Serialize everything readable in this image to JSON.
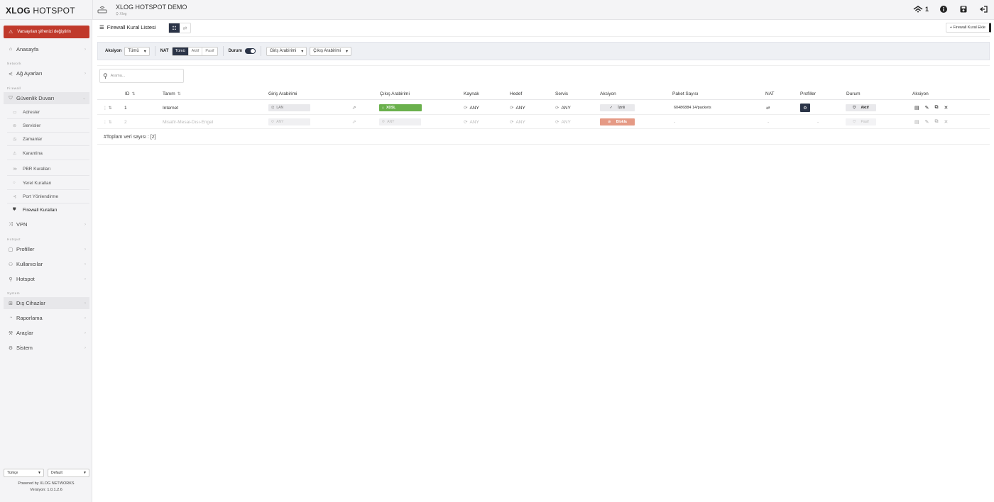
{
  "app": {
    "brand_bold": "XLOG",
    "brand_rest": " HOTSPOT",
    "workspace_title": "XLOG HOTSPOT DEMO",
    "workspace_sub": "Xlog",
    "notification_count": "1"
  },
  "sidebar": {
    "warning": "Varsayılan şifrenizi değiştirin",
    "home": "Anasayfa",
    "section_network": "Network",
    "network_settings": "Ağ Ayarları",
    "section_firewall": "Firewall",
    "firewall_group": "Güvenlik Duvarı",
    "sub_items": [
      "Adresler",
      "Servisler",
      "Zamanlar",
      "Karantina",
      "PBR Kuralları",
      "Yerel Kuralları",
      "Port Yönlendirme",
      "Firewall Kuralları"
    ],
    "vpn": "VPN",
    "section_hotspot": "Hotspot",
    "profiles": "Profiller",
    "users": "Kullanıcılar",
    "hotspot": "Hotspot",
    "section_system": "System",
    "external_devices": "Dış Cihazlar",
    "reporting": "Raporlama",
    "tools": "Araçlar",
    "system": "Sistem",
    "language": "Türkçe",
    "theme": "Default",
    "powered": "Powered by XLOG NETWORKS",
    "version": "Versiyon: 1.0.1.2.6"
  },
  "main": {
    "title": "Firewall Kural Listesi",
    "add_button": "+ Firewall Kural Ekle",
    "filters": {
      "action_label": "Aksiyon",
      "action_value": "Tümü",
      "nat_label": "NAT",
      "nat_options": [
        "Tümü",
        "Aktif",
        "Pasif"
      ],
      "status_label": "Durum",
      "in_iface": "Giriş Arabirimi",
      "out_iface": "Çıkış Arabirimi"
    },
    "search_placeholder": "Arama...",
    "columns": [
      "ID",
      "Tanım",
      "Giriş Arabirimi",
      "Çıkış Arabirimi",
      "Kaynak",
      "Hedef",
      "Servis",
      "Aksiyon",
      "Paket Sayısı",
      "NAT",
      "Profiller",
      "Durum",
      "Aksiyon"
    ],
    "rows": [
      {
        "id": "1",
        "name": "Internet",
        "in": "LAN",
        "out": "XDSL",
        "src": "ANY",
        "dst": "ANY",
        "svc": "ANY",
        "action": "İzinli",
        "packets": "60486884 14/packets",
        "status": "Aktif"
      },
      {
        "id": "2",
        "name": "Misafir-Mesai-Dısı-Engel",
        "in": "ANY",
        "out": "ANY",
        "src": "ANY",
        "dst": "ANY",
        "svc": "ANY",
        "action": "Blokla",
        "packets": "-",
        "nat": "-",
        "profiles": "-",
        "status": "Pasif"
      }
    ],
    "total": "#Toplam veri sayısı : [2]"
  },
  "colors": {
    "warning_bg": "#c0392b",
    "accent_dark": "#2b3447",
    "xdsl_green": "#6ab04c",
    "block_salmon": "#e59a85"
  }
}
